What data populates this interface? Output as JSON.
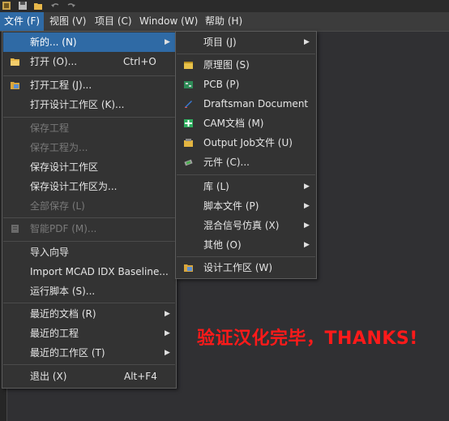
{
  "menubar": {
    "items": [
      {
        "label": "文件 (F)"
      },
      {
        "label": "视图 (V)"
      },
      {
        "label": "项目 (C)"
      },
      {
        "label": "Window (W)"
      },
      {
        "label": "帮助 (H)"
      }
    ]
  },
  "file_menu": {
    "new": {
      "label": "新的... (N)"
    },
    "open": {
      "label": "打开 (O)...",
      "shortcut": "Ctrl+O"
    },
    "open_project": {
      "label": "打开工程 (J)..."
    },
    "open_workspace": {
      "label": "打开设计工作区 (K)..."
    },
    "save_project": {
      "label": "保存工程"
    },
    "save_project_as": {
      "label": "保存工程为..."
    },
    "save_workspace": {
      "label": "保存设计工作区"
    },
    "save_workspace_as": {
      "label": "保存设计工作区为..."
    },
    "save_all": {
      "label": "全部保存 (L)"
    },
    "smart_pdf": {
      "label": "智能PDF (M)..."
    },
    "import_wizard": {
      "label": "导入向导"
    },
    "import_mcad": {
      "label": "Import MCAD IDX Baseline..."
    },
    "run_script": {
      "label": "运行脚本 (S)..."
    },
    "recent_docs": {
      "label": "最近的文档 (R)"
    },
    "recent_projects": {
      "label": "最近的工程"
    },
    "recent_workspaces": {
      "label": "最近的工作区 (T)"
    },
    "exit": {
      "label": "退出 (X)",
      "shortcut": "Alt+F4"
    }
  },
  "new_submenu": {
    "project": {
      "label": "项目 (J)"
    },
    "schematic": {
      "label": "原理图 (S)"
    },
    "pcb": {
      "label": "PCB (P)"
    },
    "draftsman": {
      "label": "Draftsman Document"
    },
    "cam": {
      "label": "CAM文档 (M)"
    },
    "output_job": {
      "label": "Output Job文件 (U)"
    },
    "component": {
      "label": "元件 (C)..."
    },
    "library": {
      "label": "库 (L)"
    },
    "script_file": {
      "label": "脚本文件 (P)"
    },
    "mixed_signal": {
      "label": "混合信号仿真 (X)"
    },
    "other": {
      "label": "其他 (O)"
    },
    "design_workspace": {
      "label": "设计工作区 (W)"
    }
  },
  "watermark": {
    "text": "验证汉化完毕，THANKS!"
  },
  "colors": {
    "accent": "#2f6aa5",
    "watermark": "#ff1a1a",
    "menu_bg": "#333333"
  },
  "icons": [
    "app-icon",
    "save-icon",
    "open-folder-icon",
    "undo-icon",
    "redo-icon",
    "open-project-icon",
    "smart-pdf-icon",
    "schematic-icon",
    "pcb-icon",
    "draftsman-icon",
    "cam-icon",
    "output-job-icon",
    "component-icon",
    "design-workspace-icon",
    "submenu-arrow-icon"
  ]
}
